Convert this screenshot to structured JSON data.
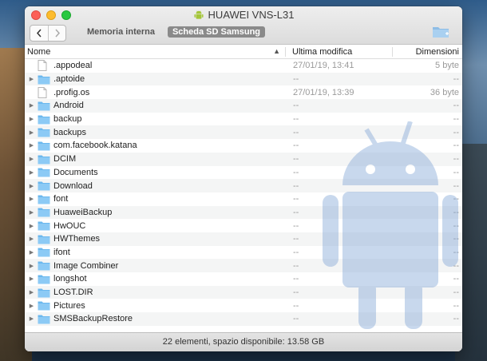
{
  "window": {
    "title": "HUAWEI VNS-L31",
    "tabs": [
      {
        "label": "Memoria interna",
        "active": false
      },
      {
        "label": "Scheda SD Samsung",
        "active": true
      }
    ]
  },
  "columns": {
    "name": "Nome",
    "modified": "Ultima modifica",
    "size": "Dimensioni"
  },
  "files": [
    {
      "name": ".appodeal",
      "type": "file",
      "modified": "27/01/19, 13:41",
      "size": "5 byte"
    },
    {
      "name": ".aptoide",
      "type": "folder",
      "modified": "--",
      "size": "--"
    },
    {
      "name": ".profig.os",
      "type": "file",
      "modified": "27/01/19, 13:39",
      "size": "36 byte"
    },
    {
      "name": "Android",
      "type": "folder",
      "modified": "--",
      "size": "--"
    },
    {
      "name": "backup",
      "type": "folder",
      "modified": "--",
      "size": "--"
    },
    {
      "name": "backups",
      "type": "folder",
      "modified": "--",
      "size": "--"
    },
    {
      "name": "com.facebook.katana",
      "type": "folder",
      "modified": "--",
      "size": "--"
    },
    {
      "name": "DCIM",
      "type": "folder",
      "modified": "--",
      "size": "--"
    },
    {
      "name": "Documents",
      "type": "folder",
      "modified": "--",
      "size": "--"
    },
    {
      "name": "Download",
      "type": "folder",
      "modified": "--",
      "size": "--"
    },
    {
      "name": "font",
      "type": "folder",
      "modified": "--",
      "size": "--"
    },
    {
      "name": "HuaweiBackup",
      "type": "folder",
      "modified": "--",
      "size": "--"
    },
    {
      "name": "HwOUC",
      "type": "folder",
      "modified": "--",
      "size": "--"
    },
    {
      "name": "HWThemes",
      "type": "folder",
      "modified": "--",
      "size": "--"
    },
    {
      "name": "ifont",
      "type": "folder",
      "modified": "--",
      "size": "--"
    },
    {
      "name": "Image Combiner",
      "type": "folder",
      "modified": "--",
      "size": "--"
    },
    {
      "name": "longshot",
      "type": "folder",
      "modified": "--",
      "size": "--"
    },
    {
      "name": "LOST.DIR",
      "type": "folder",
      "modified": "--",
      "size": "--"
    },
    {
      "name": "Pictures",
      "type": "folder",
      "modified": "--",
      "size": "--"
    },
    {
      "name": "SMSBackupRestore",
      "type": "folder",
      "modified": "--",
      "size": "--"
    }
  ],
  "status": "22 elementi, spazio disponibile: 13.58 GB",
  "colors": {
    "folder": "#6bb8ee",
    "android": "#a4c639",
    "watermark": "#7ea3d6"
  },
  "icons": {
    "back": "chevron-left-icon",
    "forward": "chevron-right-icon",
    "new_folder": "folder-plus-icon",
    "app": "android-icon"
  }
}
